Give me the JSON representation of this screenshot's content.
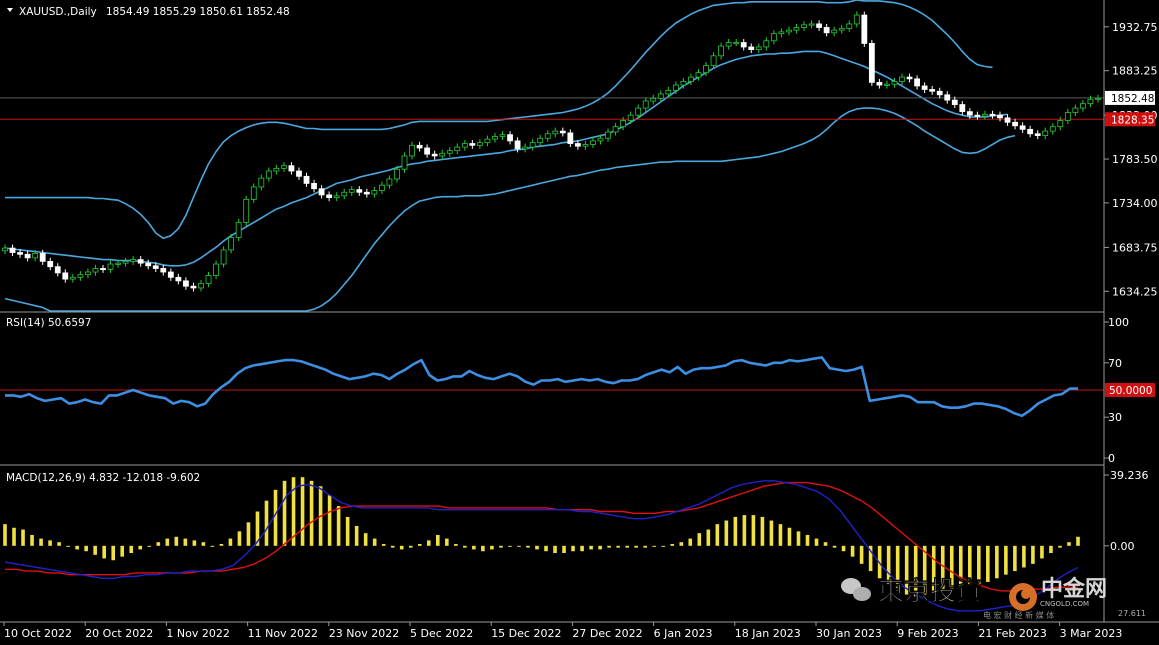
{
  "window": {
    "symbol_header": "XAUUSD.,Daily",
    "ohlc": {
      "open": 1854.49,
      "high": 1855.29,
      "low": 1850.61,
      "close": 1852.48
    },
    "ohlc_text": "1854.49 1855.29 1850.61 1852.48"
  },
  "colors": {
    "background": "#000000",
    "bull_candle": "#000000",
    "bull_outline": "#22cc33",
    "bear_candle": "#ffffff",
    "bollinger": "#4aa8e0",
    "red_line": "#c81414",
    "rsi_line": "#3d8fe3",
    "macd_hist": "#f0e040",
    "macd_main": "#1e22c8",
    "macd_signal": "#e01010",
    "axis_text": "#ffffff"
  },
  "chart_data": [
    {
      "type": "candlestick",
      "panel": "price",
      "title": "XAUUSD.,Daily",
      "price_ticks": [
        "1932.75",
        "1883.25",
        "1833.00",
        "1783.50",
        "1734.00",
        "1683.75",
        "1634.25"
      ],
      "price_tick_values": [
        1932.75,
        1883.25,
        1833.0,
        1783.5,
        1734.0,
        1683.75,
        1634.25
      ],
      "ylim": [
        1612,
        1963
      ],
      "current_price_label": "1852.48",
      "current_price": 1852.48,
      "red_level_label": "1828.35",
      "red_level": 1828.35,
      "close": [
        1683,
        1678,
        1676,
        1672,
        1677,
        1668,
        1662,
        1655,
        1648,
        1650,
        1653,
        1656,
        1660,
        1659,
        1665,
        1666,
        1668,
        1670,
        1666,
        1663,
        1660,
        1656,
        1650,
        1646,
        1640,
        1638,
        1643,
        1652,
        1665,
        1681,
        1695,
        1712,
        1738,
        1752,
        1762,
        1770,
        1773,
        1776,
        1770,
        1764,
        1756,
        1750,
        1743,
        1740,
        1742,
        1746,
        1749,
        1746,
        1744,
        1748,
        1754,
        1761,
        1772,
        1787,
        1799,
        1796,
        1789,
        1787,
        1790,
        1793,
        1797,
        1801,
        1799,
        1802,
        1806,
        1809,
        1811,
        1804,
        1795,
        1797,
        1802,
        1807,
        1812,
        1815,
        1813,
        1801,
        1798,
        1800,
        1804,
        1807,
        1814,
        1820,
        1827,
        1833,
        1841,
        1849,
        1852,
        1857,
        1861,
        1867,
        1871,
        1876,
        1881,
        1889,
        1900,
        1911,
        1915,
        1915,
        1910,
        1907,
        1910,
        1917,
        1925,
        1927,
        1929,
        1932,
        1935,
        1936,
        1932,
        1926,
        1929,
        1931,
        1936,
        1946,
        1914,
        1870,
        1867,
        1868,
        1871,
        1876,
        1874,
        1866,
        1862,
        1860,
        1856,
        1850,
        1845,
        1837,
        1833,
        1832,
        1834,
        1833,
        1830,
        1825,
        1821,
        1817,
        1812,
        1810,
        1815,
        1820,
        1827,
        1836,
        1841,
        1846,
        1851,
        1852
      ],
      "bollinger": {
        "upper": [
          1740,
          1740,
          1740,
          1740,
          1740,
          1740,
          1740,
          1740,
          1740,
          1740,
          1740,
          1740,
          1739,
          1739,
          1738,
          1737,
          1733,
          1728,
          1721,
          1712,
          1700,
          1694,
          1697,
          1705,
          1720,
          1740,
          1760,
          1778,
          1792,
          1803,
          1810,
          1815,
          1819,
          1822,
          1824,
          1825,
          1825,
          1824,
          1822,
          1820,
          1818,
          1818,
          1817,
          1817,
          1817,
          1817,
          1817,
          1817,
          1817,
          1817,
          1817,
          1818,
          1820,
          1822,
          1825,
          1826,
          1826,
          1826,
          1826,
          1826,
          1826,
          1826,
          1826,
          1826,
          1826,
          1827,
          1828,
          1829,
          1830,
          1831,
          1832,
          1833,
          1834,
          1835,
          1836,
          1838,
          1840,
          1843,
          1847,
          1852,
          1858,
          1866,
          1875,
          1884,
          1894,
          1904,
          1913,
          1922,
          1930,
          1937,
          1942,
          1947,
          1951,
          1954,
          1957,
          1958,
          1959,
          1960,
          1960,
          1961,
          1961,
          1961,
          1961,
          1961,
          1961,
          1961,
          1961,
          1961,
          1961,
          1960,
          1960,
          1960,
          1961,
          1963,
          1962,
          1962,
          1962,
          1961,
          1960,
          1958,
          1955,
          1951,
          1946,
          1940,
          1932,
          1924,
          1915,
          1905,
          1896,
          1890,
          1888,
          1887
        ],
        "middle": [
          1683,
          1682,
          1681,
          1680,
          1679,
          1678,
          1677,
          1676,
          1675,
          1674,
          1673,
          1672,
          1671,
          1670,
          1670,
          1669,
          1669,
          1669,
          1668,
          1667,
          1666,
          1664,
          1663,
          1663,
          1664,
          1667,
          1672,
          1678,
          1684,
          1691,
          1697,
          1702,
          1707,
          1712,
          1717,
          1722,
          1727,
          1730,
          1734,
          1737,
          1740,
          1744,
          1748,
          1752,
          1756,
          1758,
          1760,
          1763,
          1765,
          1767,
          1769,
          1771,
          1774,
          1776,
          1778,
          1779,
          1781,
          1782,
          1783,
          1784,
          1785,
          1786,
          1787,
          1788,
          1789,
          1790,
          1791,
          1793,
          1794,
          1795,
          1797,
          1798,
          1799,
          1800,
          1802,
          1803,
          1804,
          1806,
          1808,
          1810,
          1812,
          1816,
          1820,
          1825,
          1830,
          1836,
          1842,
          1848,
          1854,
          1860,
          1866,
          1871,
          1876,
          1881,
          1886,
          1890,
          1893,
          1896,
          1898,
          1900,
          1901,
          1902,
          1902,
          1903,
          1903,
          1904,
          1905,
          1905,
          1905,
          1903,
          1900,
          1897,
          1894,
          1891,
          1888,
          1884,
          1880,
          1876,
          1871,
          1866,
          1861,
          1856,
          1851,
          1846,
          1842,
          1838,
          1835,
          1833,
          1831,
          1831,
          1831,
          1832,
          1833,
          1834
        ],
        "lower": [
          1626,
          1624,
          1622,
          1620,
          1618,
          1616,
          1612,
          1612,
          1612,
          1612,
          1612,
          1612,
          1612,
          1612,
          1612,
          1612,
          1612,
          1612,
          1612,
          1612,
          1612,
          1612,
          1612,
          1612,
          1612,
          1612,
          1612,
          1612,
          1612,
          1612,
          1612,
          1612,
          1612,
          1612,
          1612,
          1612,
          1612,
          1612,
          1612,
          1612,
          1612,
          1614,
          1618,
          1624,
          1632,
          1642,
          1652,
          1664,
          1676,
          1688,
          1698,
          1708,
          1717,
          1725,
          1731,
          1736,
          1738,
          1740,
          1741,
          1741,
          1741,
          1742,
          1742,
          1742,
          1743,
          1744,
          1746,
          1748,
          1750,
          1752,
          1754,
          1756,
          1758,
          1760,
          1762,
          1764,
          1765,
          1767,
          1769,
          1771,
          1772,
          1774,
          1775,
          1776,
          1777,
          1778,
          1779,
          1780,
          1780,
          1781,
          1781,
          1781,
          1781,
          1781,
          1781,
          1781,
          1782,
          1783,
          1784,
          1785,
          1786,
          1788,
          1790,
          1792,
          1795,
          1798,
          1801,
          1805,
          1810,
          1817,
          1825,
          1832,
          1837,
          1840,
          1841,
          1841,
          1840,
          1838,
          1835,
          1831,
          1826,
          1821,
          1815,
          1810,
          1805,
          1800,
          1795,
          1791,
          1790,
          1791,
          1795,
          1800,
          1805,
          1808,
          1810
        ]
      }
    },
    {
      "type": "line",
      "panel": "rsi",
      "title": "RSI(14) 50.6597",
      "ylim": [
        0,
        100
      ],
      "tick_labels": [
        "100",
        "70",
        "30",
        "0"
      ],
      "tick_values": [
        100,
        70,
        30,
        0
      ],
      "level_label": "50.0000",
      "level": 50,
      "values": [
        46,
        46,
        45,
        47,
        44,
        42,
        43,
        44,
        40,
        41,
        43,
        41,
        40,
        46,
        46,
        48,
        50,
        48,
        46,
        45,
        44,
        40,
        42,
        41,
        38,
        40,
        47,
        52,
        56,
        62,
        66,
        68,
        69,
        70,
        71,
        72,
        72,
        71,
        69,
        67,
        65,
        62,
        60,
        58,
        59,
        60,
        62,
        61,
        58,
        62,
        65,
        69,
        72,
        61,
        57,
        58,
        60,
        60,
        64,
        61,
        59,
        58,
        60,
        62,
        60,
        56,
        54,
        57,
        57,
        58,
        56,
        57,
        58,
        57,
        58,
        56,
        55,
        57,
        57,
        58,
        61,
        63,
        65,
        63,
        67,
        62,
        65,
        66,
        66,
        67,
        68,
        71,
        72,
        70,
        69,
        68,
        70,
        70,
        72,
        71,
        72,
        73,
        74,
        66,
        65,
        64,
        65,
        67,
        42,
        43,
        44,
        45,
        46,
        45,
        41,
        41,
        41,
        38,
        37,
        37,
        38,
        40,
        40,
        39,
        38,
        36,
        33,
        31,
        35,
        40,
        43,
        46,
        47,
        51,
        51
      ]
    },
    {
      "type": "bar+line",
      "panel": "macd",
      "title": "MACD(12,26,9) 4.832 -12.018 -9.602",
      "macd_params": "12,26,9",
      "ylim": [
        -40,
        42
      ],
      "tick_labels": [
        "39.236",
        "0.00"
      ],
      "tick_values": [
        39.236,
        0
      ],
      "histogram": [
        12,
        10,
        9,
        6,
        4,
        3,
        2,
        0,
        -2,
        -3,
        -5,
        -7,
        -8,
        -6,
        -4,
        -2,
        0,
        2,
        4,
        5,
        4,
        3,
        2,
        0,
        1,
        4,
        8,
        13,
        19,
        25,
        31,
        36,
        38,
        38,
        36,
        33,
        28,
        22,
        16,
        11,
        7,
        4,
        1,
        -1,
        -2,
        -1,
        1,
        3,
        6,
        4,
        1,
        -1,
        -2,
        -3,
        -2,
        -1,
        0,
        0,
        -1,
        -2,
        -3,
        -4,
        -4,
        -3,
        -3,
        -2,
        -2,
        -1,
        -1,
        -1,
        -1,
        -1,
        0,
        0,
        1,
        2,
        4,
        7,
        9,
        12,
        14,
        16,
        17,
        17,
        16,
        14,
        12,
        10,
        8,
        6,
        4,
        2,
        -1,
        -3,
        -6,
        -10,
        -14,
        -18,
        -22,
        -25,
        -27,
        -28,
        -27,
        -26,
        -25,
        -24,
        -23,
        -22,
        -21,
        -20,
        -18,
        -16,
        -14,
        -12,
        -10,
        -7,
        -4,
        -1,
        2,
        5
      ],
      "main": [
        -9,
        -10,
        -11,
        -12,
        -13,
        -14,
        -15,
        -16,
        -17,
        -18,
        -18,
        -17,
        -17,
        -16,
        -16,
        -15,
        -15,
        -14,
        -14,
        -14,
        -13,
        -11,
        -6,
        0,
        8,
        18,
        28,
        33,
        34,
        32,
        28,
        24,
        22,
        21,
        21,
        21,
        21,
        21,
        21,
        21,
        20,
        20,
        20,
        20,
        20,
        20,
        20,
        20,
        20,
        20,
        20,
        20,
        20,
        19,
        19,
        18,
        17,
        16,
        15,
        15,
        16,
        17,
        19,
        21,
        23,
        26,
        29,
        32,
        34,
        35,
        36,
        36,
        35,
        34,
        32,
        30,
        26,
        20,
        12,
        4,
        -4,
        -12,
        -18,
        -23,
        -27,
        -30,
        -33,
        -35,
        -36,
        -36,
        -36,
        -35,
        -34,
        -33,
        -31,
        -28,
        -24,
        -19,
        -15,
        -12
      ],
      "signal": [
        -13,
        -13,
        -14,
        -14,
        -15,
        -15,
        -16,
        -16,
        -16,
        -16,
        -16,
        -16,
        -15,
        -15,
        -15,
        -15,
        -15,
        -15,
        -14,
        -14,
        -14,
        -13,
        -12,
        -10,
        -7,
        -3,
        2,
        7,
        12,
        16,
        19,
        21,
        22,
        22,
        22,
        22,
        22,
        22,
        22,
        22,
        22,
        21,
        21,
        21,
        21,
        21,
        21,
        21,
        21,
        21,
        21,
        20,
        20,
        20,
        20,
        19,
        19,
        19,
        18,
        18,
        18,
        19,
        19,
        20,
        21,
        23,
        25,
        27,
        29,
        31,
        33,
        34,
        35,
        35,
        35,
        34,
        33,
        31,
        28,
        25,
        21,
        16,
        11,
        6,
        1,
        -4,
        -9,
        -13,
        -17,
        -20,
        -22,
        -24,
        -25,
        -25,
        -25,
        -24,
        -24,
        -23,
        -23,
        -23
      ]
    }
  ],
  "date_axis": {
    "labels": [
      "10 Oct 2022",
      "20 Oct 2022",
      "1 Nov 2022",
      "11 Nov 2022",
      "23 Nov 2022",
      "5 Dec 2022",
      "15 Dec 2022",
      "27 Dec 2022",
      "6 Jan 2023",
      "18 Jan 2023",
      "30 Jan 2023",
      "9 Feb 2023",
      "21 Feb 2023",
      "3 Mar 2023"
    ]
  },
  "watermark": {
    "left_text": "東京投資",
    "right_text": "中金网",
    "right_sub": "CNGOLD.COM",
    "bottom_text": "电 宏 财 经 新 媒 体",
    "corner_numbers": "27.611"
  }
}
